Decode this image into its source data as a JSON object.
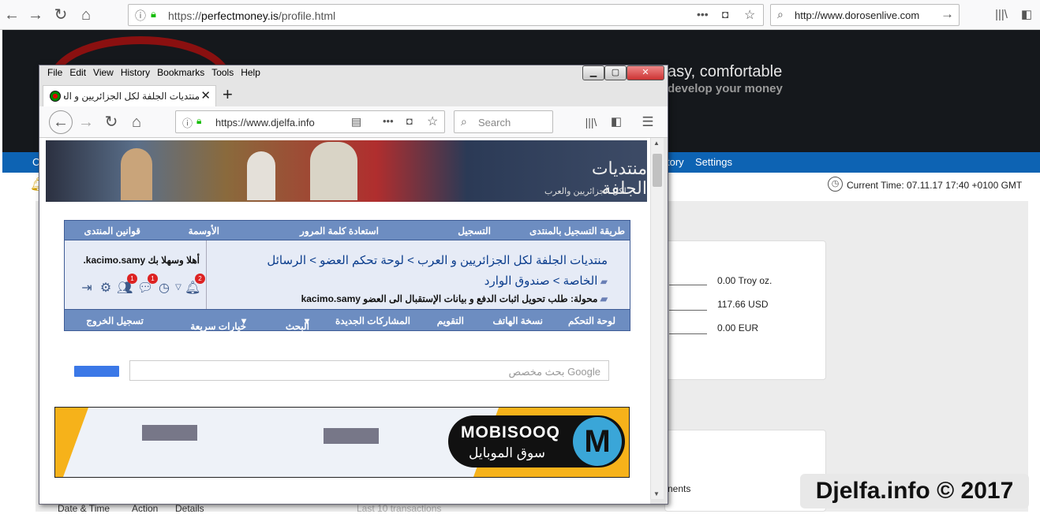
{
  "outer_browser": {
    "url_scheme": "https://",
    "url_domain": "perfectmoney.is",
    "url_path": "/profile.html",
    "search_text": "http://www.dorosenlive.com",
    "more_label": "•••"
  },
  "background_site": {
    "slogan_line1": "asy, comfortable",
    "slogan_line2": "develop your money",
    "nav_items": [
      "C",
      "tory",
      "Settings"
    ],
    "current_time": "Current Time: 07.11.17 17:40 +0100 GMT",
    "balances": [
      "0.00 Troy oz.",
      "117.66 USD",
      "0.00 EUR"
    ],
    "box2_text": "nents",
    "table_headers": [
      "Date & Time",
      "Action",
      "Details",
      "Last 10 transactions"
    ],
    "watermark": "Djelfa.info © 2017"
  },
  "inner_window": {
    "menu": [
      "File",
      "Edit",
      "View",
      "History",
      "Bookmarks",
      "Tools",
      "Help"
    ],
    "tab_title": "منتديات الجلفة لكل الجزائريين و العرب",
    "new_tab": "+",
    "url": "https://www.djelfa.info",
    "search_placeholder": "Search",
    "more_label": "•••"
  },
  "forum": {
    "logo_title": "منتديات الجلفة",
    "logo_subtitle": "لكل الجزائريين والعرب",
    "top_links": [
      "طريقة التسجيل بالمنتدى",
      "التسجيل",
      "استعادة كلمة المرور",
      "الأوسمة",
      "قوانين المنتدى"
    ],
    "breadcrumb_line1": "منتديات الجلفة لكل الجزائريين و العرب > لوحة تحكم العضو > الرسائل",
    "breadcrumb_line2": "الخاصة > صندوق الوارد",
    "breadcrumb_line3": "محولة: طلب تحويل اثبات الدفع و بيانات الإستقبال الى العضو kacimo.samy",
    "welcome": "أهلا وسهلا بك kacimo.samy.",
    "badges": {
      "notifications": "2",
      "messages": "1",
      "friends": "1"
    },
    "bottom_links": [
      "لوحة التحكم",
      "نسخة الهاتف",
      "التقويم",
      "المشاركات الجديدة",
      "البحث",
      "خيارات سريعة",
      "تسجيل الخروج"
    ],
    "google_search": "Google بحث مخصص",
    "ad": {
      "brand": "MOBISOOQ",
      "brand_ar": "سوق الموبايل",
      "letter": "M"
    }
  }
}
